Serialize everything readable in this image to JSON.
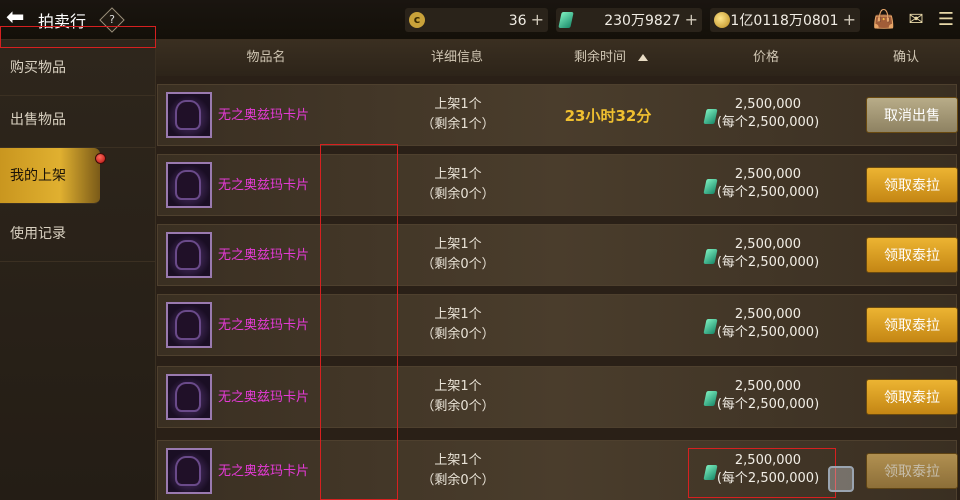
{
  "header": {
    "title": "拍卖行",
    "help_label": "?",
    "resources": [
      {
        "name": "coupon",
        "value": "36"
      },
      {
        "name": "gem",
        "value": "230万9827"
      },
      {
        "name": "gold",
        "value": "1亿0118万0801"
      }
    ],
    "plus": "+"
  },
  "sidebar": {
    "items": [
      {
        "label": "购买物品"
      },
      {
        "label": "出售物品"
      },
      {
        "label": "我的上架"
      },
      {
        "label": "使用记录"
      }
    ],
    "active_index": 2
  },
  "columns": {
    "name": "物品名",
    "detail": "详细信息",
    "time": "剩余时间",
    "price": "价格",
    "confirm": "确认"
  },
  "rows": [
    {
      "name": "无之奥兹玛卡片",
      "detail_line1": "上架1个",
      "detail_line2": "（剩余1个）",
      "time": "23小时32分",
      "price": "2,500,000",
      "unit_price": "(每个2,500,000)",
      "button": "取消出售",
      "button_style": "cancel"
    },
    {
      "name": "无之奥兹玛卡片",
      "detail_line1": "上架1个",
      "detail_line2": "（剩余0个）",
      "time": "",
      "price": "2,500,000",
      "unit_price": "(每个2,500,000)",
      "button": "领取泰拉",
      "button_style": "claim"
    },
    {
      "name": "无之奥兹玛卡片",
      "detail_line1": "上架1个",
      "detail_line2": "（剩余0个）",
      "time": "",
      "price": "2,500,000",
      "unit_price": "(每个2,500,000)",
      "button": "领取泰拉",
      "button_style": "claim"
    },
    {
      "name": "无之奥兹玛卡片",
      "detail_line1": "上架1个",
      "detail_line2": "（剩余0个）",
      "time": "",
      "price": "2,500,000",
      "unit_price": "(每个2,500,000)",
      "button": "领取泰拉",
      "button_style": "claim"
    },
    {
      "name": "无之奥兹玛卡片",
      "detail_line1": "上架1个",
      "detail_line2": "（剩余0个）",
      "time": "",
      "price": "2,500,000",
      "unit_price": "(每个2,500,000)",
      "button": "领取泰拉",
      "button_style": "claim"
    },
    {
      "name": "无之奥兹玛卡片",
      "detail_line1": "上架1个",
      "detail_line2": "（剩余0个）",
      "time": "",
      "price": "2,500,000",
      "unit_price": "(每个2,500,000)",
      "button": "领取泰拉",
      "button_style": "dim"
    }
  ],
  "colors": {
    "item_name": "#e63ad8",
    "time": "#f0c030",
    "claim_button": "#e0a424",
    "annotation_box": "#d62020"
  }
}
